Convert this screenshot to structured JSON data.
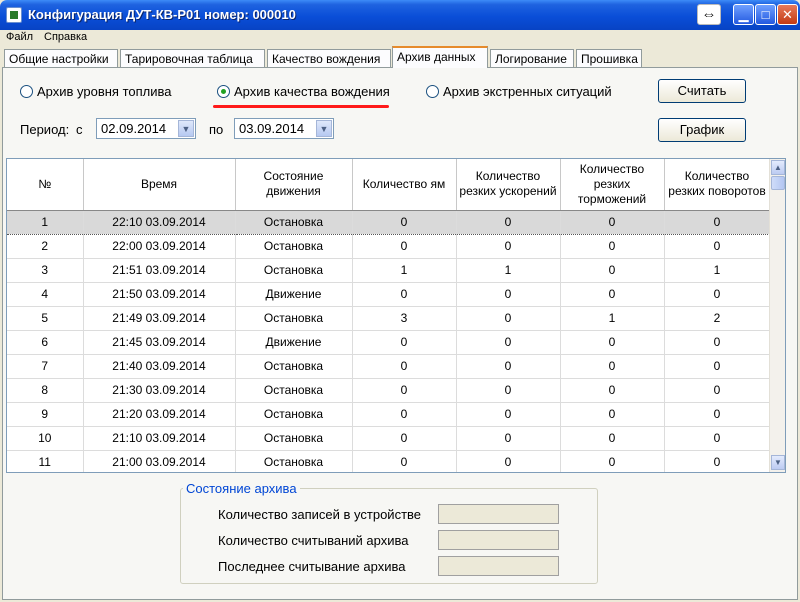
{
  "window": {
    "title": "Конфигурация ДУТ-КВ-Р01 номер: 000010",
    "resize_glyph": "⇔",
    "min_glyph": "▁",
    "max_glyph": "□",
    "close_glyph": "✕"
  },
  "menu": [
    "Файл",
    "Справка"
  ],
  "tabs": [
    "Общие настройки",
    "Тарировочная таблица",
    "Качество вождения",
    "Архив данных",
    "Логирование",
    "Прошивка"
  ],
  "active_tab": "Архив данных",
  "radios": [
    {
      "label": "Архив уровня топлива",
      "checked": false
    },
    {
      "label": "Архив качества вождения",
      "checked": true
    },
    {
      "label": "Архив экстренных ситуаций",
      "checked": false
    }
  ],
  "period": {
    "label": "Период:",
    "from_label": "с",
    "from": "02.09.2014",
    "to_label": "по",
    "to": "03.09.2014",
    "dropdown_glyph": "▼"
  },
  "buttons": {
    "read": "Считать",
    "chart": "График"
  },
  "scroll": {
    "up_glyph": "▲",
    "down_glyph": "▼"
  },
  "table": {
    "columns": [
      "№",
      "Время",
      "Состояние движения",
      "Количество ям",
      "Количество резких ускорений",
      "Количество резких торможений",
      "Количество резких поворотов"
    ],
    "rows": [
      [
        "1",
        "22:10  03.09.2014",
        "Остановка",
        "0",
        "0",
        "0",
        "0"
      ],
      [
        "2",
        "22:00  03.09.2014",
        "Остановка",
        "0",
        "0",
        "0",
        "0"
      ],
      [
        "3",
        "21:51  03.09.2014",
        "Остановка",
        "1",
        "1",
        "0",
        "1"
      ],
      [
        "4",
        "21:50  03.09.2014",
        "Движение",
        "0",
        "0",
        "0",
        "0"
      ],
      [
        "5",
        "21:49  03.09.2014",
        "Остановка",
        "3",
        "0",
        "1",
        "2"
      ],
      [
        "6",
        "21:45  03.09.2014",
        "Движение",
        "0",
        "0",
        "0",
        "0"
      ],
      [
        "7",
        "21:40  03.09.2014",
        "Остановка",
        "0",
        "0",
        "0",
        "0"
      ],
      [
        "8",
        "21:30  03.09.2014",
        "Остановка",
        "0",
        "0",
        "0",
        "0"
      ],
      [
        "9",
        "21:20  03.09.2014",
        "Остановка",
        "0",
        "0",
        "0",
        "0"
      ],
      [
        "10",
        "21:10  03.09.2014",
        "Остановка",
        "0",
        "0",
        "0",
        "0"
      ],
      [
        "11",
        "21:00  03.09.2014",
        "Остановка",
        "0",
        "0",
        "0",
        "0"
      ]
    ],
    "selected_row": 0
  },
  "archive_state": {
    "title": "Состояние архива",
    "records_label": "Количество записей в устройстве",
    "records_value": "",
    "reads_label": "Количество считываний архива",
    "reads_value": "",
    "last_read_label": "Последнее считывание архива",
    "last_read_value": ""
  },
  "colors": {
    "accent_underline": "#ff1a1a",
    "titlebar": "#0a4ed8",
    "tab_highlight": "#e68b2c"
  }
}
